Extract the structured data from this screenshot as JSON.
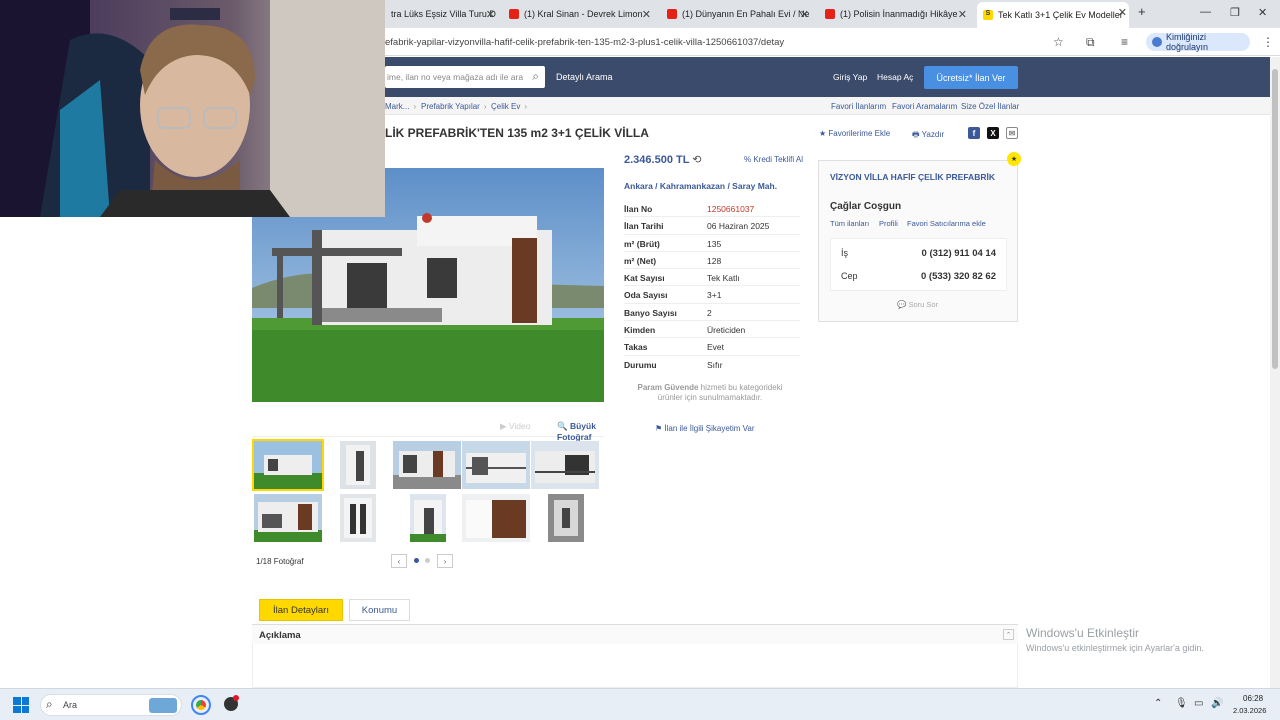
{
  "browser": {
    "tabs": [
      {
        "label": "tra Lüks Eşsiz Villa Turu D",
        "color": "#e62117"
      },
      {
        "label": "(1) Kral Sinan - Devrek Limon",
        "color": "#e62117"
      },
      {
        "label": "(1) Dünyanın En Pahalı Evi / Ne",
        "color": "#e62117"
      },
      {
        "label": "(1) Polisin İnanmadığı Hikâye",
        "color": "#e62117"
      },
      {
        "label": "Tek Katlı 3+1 Çelik Ev Modeller",
        "color": "#ffd800"
      }
    ],
    "new_tab": "+",
    "url": "efabrik-yapilar-vizyonvilla-hafif-celik-prefabrik-ten-135-m2-3-plus1-celik-villa-1250661037/detay",
    "profile_label": "Kimliğinizi doğrulayın"
  },
  "site": {
    "search_placeholder": "ime, ilan no veya mağaza adı ile ara",
    "advanced_search": "Detaylı Arama",
    "login": "Giriş Yap",
    "register": "Hesap Aç",
    "post_ad": "Ücretsiz* İlan Ver"
  },
  "breadcrumb": {
    "items": [
      "Mark...",
      "Prefabrik Yapılar",
      "Çelik Ev"
    ],
    "right_links": [
      "Favori İlanlarım",
      "Favori Aramalarım",
      "Size Özel İlanlar"
    ]
  },
  "listing": {
    "title": "LİK PREFABRİK'TEN 135 m2 3+1 ÇELİK VİLLA",
    "add_favorite": "Favorilerime Ekle",
    "print": "Yazdır",
    "price": "2.346.500 TL",
    "credit": "Kredi Teklifi Al",
    "location": "Ankara  /  Kahramankazan  /  Saray Mah.",
    "details": [
      {
        "label": "İlan No",
        "value": "1250661037",
        "highlight": true
      },
      {
        "label": "İlan Tarihi",
        "value": "06 Haziran 2025"
      },
      {
        "label": "m² (Brüt)",
        "value": "135"
      },
      {
        "label": "m² (Net)",
        "value": "128"
      },
      {
        "label": "Kat Sayısı",
        "value": "Tek Katlı"
      },
      {
        "label": "Oda Sayısı",
        "value": "3+1"
      },
      {
        "label": "Banyo Sayısı",
        "value": "2"
      },
      {
        "label": "Kimden",
        "value": "Üreticiden"
      },
      {
        "label": "Takas",
        "value": "Evet"
      },
      {
        "label": "Durumu",
        "value": "Sıfır"
      }
    ],
    "param_bold": "Param Güvende",
    "param_text": " hizmeti bu kategorideki ürünler için sunulmamaktadır.",
    "complaint": "İlan ile İlgili Şikayetim Var",
    "big_photo": "Büyük Fotoğraf",
    "video": "Video",
    "photo_count": "1/18 Fotoğraf"
  },
  "seller": {
    "company": "VİZYON VİLLA HAFİF ÇELİK PREFABRİK",
    "name": "Çağlar Coşgun",
    "links": [
      "Tüm ilanları",
      "Profili",
      "Favori Satıcılarıma ekle"
    ],
    "phones": [
      {
        "label": "İş",
        "value": "0 (312) 911 04 14"
      },
      {
        "label": "Cep",
        "value": "0 (533) 320 82 62"
      }
    ],
    "ask": "Soru Sor"
  },
  "bottom": {
    "tab_details": "İlan Detayları",
    "tab_location": "Konumu",
    "description_title": "Açıklama"
  },
  "watermark": {
    "line1": "Windows'u Etkinleştir",
    "line2": "Windows'u etkinleştirmek için Ayarlar'a gidin."
  },
  "taskbar": {
    "search_label": "Ara",
    "time": "06:28",
    "date": "2.03.2026"
  },
  "colors": {
    "header": "#3b4b6b",
    "accent_yellow": "#ffd800",
    "link_blue": "#3b5998",
    "listing_no_red": "#c0392b"
  }
}
